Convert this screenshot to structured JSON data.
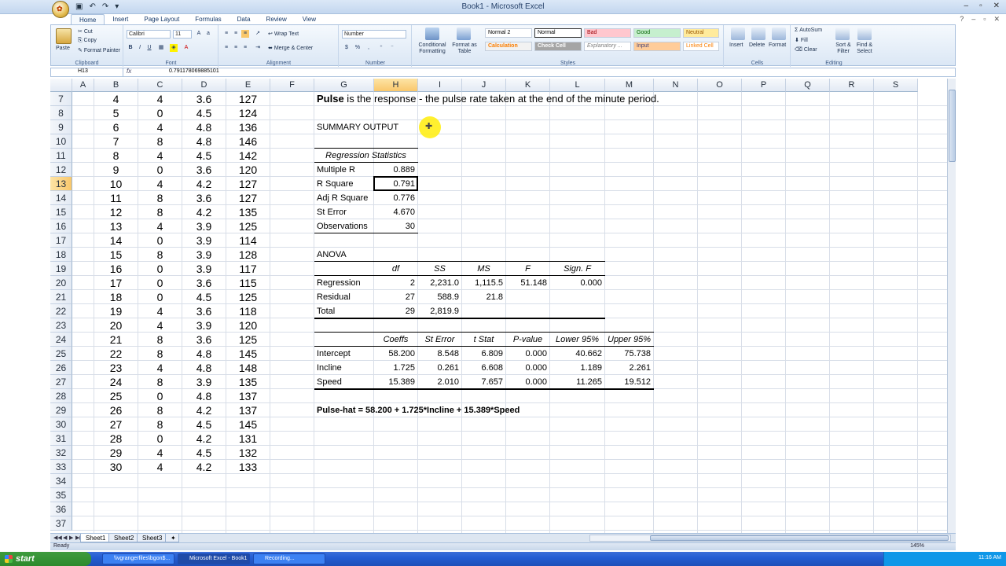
{
  "window": {
    "title": "Book1 - Microsoft Excel"
  },
  "ribbon": {
    "tabs": [
      "Home",
      "Insert",
      "Page Layout",
      "Formulas",
      "Data",
      "Review",
      "View"
    ],
    "clipboard": {
      "paste": "Paste",
      "cut": "Cut",
      "copy": "Copy",
      "format_painter": "Format Painter",
      "label": "Clipboard"
    },
    "font": {
      "name": "Calibri",
      "size": "11",
      "label": "Font"
    },
    "alignment": {
      "wrap_text": "Wrap Text",
      "merge_center": "Merge & Center",
      "label": "Alignment"
    },
    "number": {
      "format": "Number",
      "label": "Number"
    },
    "styles": {
      "conditional": "Conditional Formatting",
      "format_table": "Format as Table",
      "cells": [
        "Normal 2",
        "Normal",
        "Bad",
        "Good",
        "Neutral",
        "Calculation",
        "Check Cell",
        "Explanatory ...",
        "Input",
        "Linked Cell"
      ],
      "label": "Styles"
    },
    "cells_group": {
      "insert": "Insert",
      "delete": "Delete",
      "format": "Format",
      "label": "Cells"
    },
    "editing": {
      "autosum": "AutoSum",
      "fill": "Fill",
      "clear": "Clear",
      "sort_filter": "Sort & Filter",
      "find_select": "Find & Select",
      "label": "Editing"
    }
  },
  "formula_bar": {
    "name_box": "H13",
    "fx": "fx",
    "formula": "0.791178069885101"
  },
  "columns": [
    "A",
    "B",
    "C",
    "D",
    "E",
    "F",
    "G",
    "H",
    "I",
    "J",
    "K",
    "L",
    "M",
    "N",
    "O",
    "P",
    "Q",
    "R",
    "S"
  ],
  "rows": [
    "7",
    "8",
    "9",
    "10",
    "11",
    "12",
    "13",
    "14",
    "15",
    "16",
    "17",
    "18",
    "19",
    "20",
    "21",
    "22",
    "23",
    "24",
    "25",
    "26",
    "27",
    "28",
    "29",
    "30",
    "31",
    "32",
    "33",
    "34",
    "35",
    "36",
    "37"
  ],
  "data_rows": [
    [
      "4",
      "4",
      "3.6",
      "127"
    ],
    [
      "5",
      "0",
      "4.5",
      "124"
    ],
    [
      "6",
      "4",
      "4.8",
      "136"
    ],
    [
      "7",
      "8",
      "4.8",
      "146"
    ],
    [
      "8",
      "4",
      "4.5",
      "142"
    ],
    [
      "9",
      "0",
      "3.6",
      "120"
    ],
    [
      "10",
      "4",
      "4.2",
      "127"
    ],
    [
      "11",
      "8",
      "3.6",
      "127"
    ],
    [
      "12",
      "8",
      "4.2",
      "135"
    ],
    [
      "13",
      "4",
      "3.9",
      "125"
    ],
    [
      "14",
      "0",
      "3.9",
      "114"
    ],
    [
      "15",
      "8",
      "3.9",
      "128"
    ],
    [
      "16",
      "0",
      "3.9",
      "117"
    ],
    [
      "17",
      "0",
      "3.6",
      "115"
    ],
    [
      "18",
      "0",
      "4.5",
      "125"
    ],
    [
      "19",
      "4",
      "3.6",
      "118"
    ],
    [
      "20",
      "4",
      "3.9",
      "120"
    ],
    [
      "21",
      "8",
      "3.6",
      "125"
    ],
    [
      "22",
      "8",
      "4.8",
      "145"
    ],
    [
      "23",
      "4",
      "4.8",
      "148"
    ],
    [
      "24",
      "8",
      "3.9",
      "135"
    ],
    [
      "25",
      "0",
      "4.8",
      "137"
    ],
    [
      "26",
      "8",
      "4.2",
      "137"
    ],
    [
      "27",
      "8",
      "4.5",
      "145"
    ],
    [
      "28",
      "0",
      "4.2",
      "131"
    ],
    [
      "29",
      "4",
      "4.5",
      "132"
    ],
    [
      "30",
      "4",
      "4.2",
      "133"
    ]
  ],
  "output": {
    "note_bold": "Pulse",
    "note_rest": " is the response - the pulse rate taken at the end of the minute period.",
    "summary_title": "SUMMARY OUTPUT",
    "reg_stats_header": "Regression Statistics",
    "reg_stats": [
      {
        "label": "Multiple R",
        "value": "0.889"
      },
      {
        "label": "R Square",
        "value": "0.791"
      },
      {
        "label": "Adj R Square",
        "value": "0.776"
      },
      {
        "label": "St Error",
        "value": "4.670"
      },
      {
        "label": "Observations",
        "value": "30"
      }
    ],
    "anova_title": "ANOVA",
    "anova_headers": [
      "df",
      "SS",
      "MS",
      "F",
      "Sign. F"
    ],
    "anova_rows": [
      {
        "label": "Regression",
        "df": "2",
        "ss": "2,231.0",
        "ms": "1,115.5",
        "f": "51.148",
        "sig": "0.000"
      },
      {
        "label": "Residual",
        "df": "27",
        "ss": "588.9",
        "ms": "21.8",
        "f": "",
        "sig": ""
      },
      {
        "label": "Total",
        "df": "29",
        "ss": "2,819.9",
        "ms": "",
        "f": "",
        "sig": ""
      }
    ],
    "coef_headers": [
      "Coeffs",
      "St Error",
      "t Stat",
      "P-value",
      "Lower 95%",
      "Upper 95%"
    ],
    "coef_rows": [
      {
        "label": "Intercept",
        "vals": [
          "58.200",
          "8.548",
          "6.809",
          "0.000",
          "40.662",
          "75.738"
        ]
      },
      {
        "label": "Incline",
        "vals": [
          "1.725",
          "0.261",
          "6.608",
          "0.000",
          "1.189",
          "2.261"
        ]
      },
      {
        "label": "Speed",
        "vals": [
          "15.389",
          "2.010",
          "7.657",
          "0.000",
          "11.265",
          "19.512"
        ]
      }
    ],
    "equation": "Pulse-hat = 58.200 + 1.725*Incline + 15.389*Speed"
  },
  "sheets": [
    "Sheet1",
    "Sheet2",
    "Sheet3"
  ],
  "status": {
    "text": "Ready",
    "zoom": "145%"
  },
  "taskbar": {
    "start": "start",
    "tasks": [
      "\\\\vgrangerfiles\\bgon$...",
      "Microsoft Excel - Book1",
      "Recording..."
    ],
    "clock": "11:16 AM"
  }
}
